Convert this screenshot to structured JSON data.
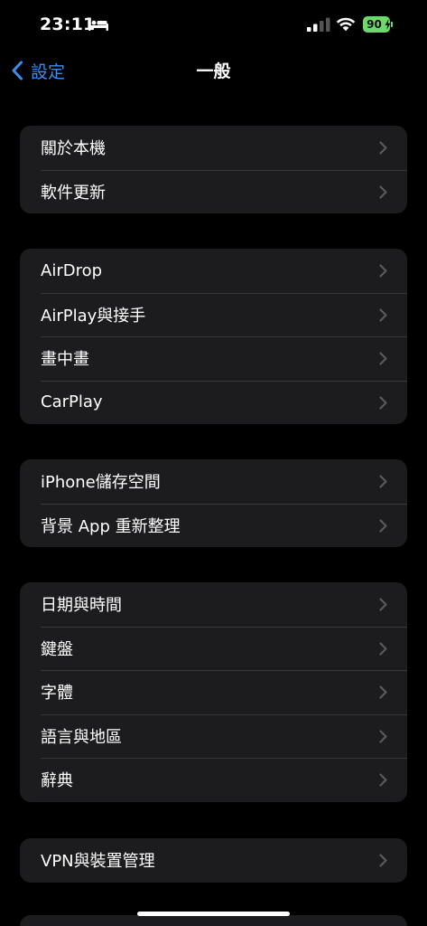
{
  "status_bar": {
    "time": "23:11",
    "battery": "90",
    "battery_color": "#6cd96c",
    "icons": [
      "bed-icon",
      "cellular-signal-icon",
      "wifi-icon",
      "battery-icon",
      "charging-bolt-icon"
    ]
  },
  "nav": {
    "back_label": "設定",
    "title": "一般",
    "accent_color": "#3b8ef0"
  },
  "groups": [
    {
      "items": [
        {
          "label": "關於本機"
        },
        {
          "label": "軟件更新"
        }
      ]
    },
    {
      "items": [
        {
          "label": "AirDrop"
        },
        {
          "label": "AirPlay與接手"
        },
        {
          "label": "畫中畫"
        },
        {
          "label": "CarPlay"
        }
      ]
    },
    {
      "items": [
        {
          "label": "iPhone儲存空間"
        },
        {
          "label": "背景 App 重新整理"
        }
      ]
    },
    {
      "items": [
        {
          "label": "日期與時間"
        },
        {
          "label": "鍵盤"
        },
        {
          "label": "字體"
        },
        {
          "label": "語言與地區"
        },
        {
          "label": "辭典"
        }
      ]
    },
    {
      "items": [
        {
          "label": "VPN與裝置管理"
        }
      ]
    }
  ],
  "colors": {
    "background": "#000000",
    "cell_background": "#1c1c1e",
    "separator": "#38383a",
    "chevron": "#5a5a5e"
  }
}
